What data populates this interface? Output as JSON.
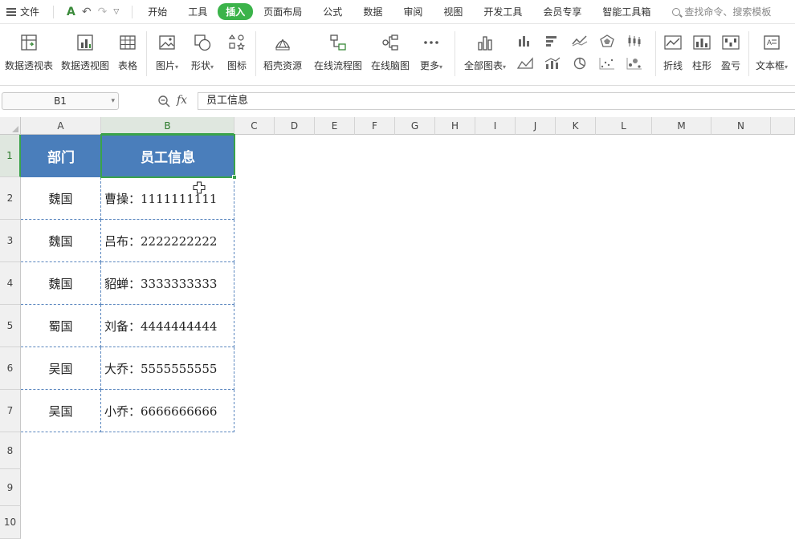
{
  "menu": {
    "file_label": "文件",
    "tabs": [
      "开始",
      "工具",
      "插入",
      "页面布局",
      "公式",
      "数据",
      "审阅",
      "视图",
      "开发工具",
      "会员专享",
      "智能工具箱"
    ],
    "active_tab": "插入",
    "search_placeholder": "查找命令、搜索模板"
  },
  "ribbon": {
    "pivot_table": "数据透视表",
    "pivot_chart": "数据透视图",
    "table": "表格",
    "picture": "图片",
    "shape": "形状",
    "icon": "图标",
    "resources": "稻壳资源",
    "flowchart": "在线流程图",
    "mindmap": "在线脑图",
    "more": "更多",
    "all_charts": "全部图表",
    "line": "折线",
    "column": "柱形",
    "winloss": "盈亏",
    "textbox": "文本框"
  },
  "formula_bar": {
    "name_box": "B1",
    "fx": "fx",
    "content": "员工信息"
  },
  "sheet": {
    "columns": [
      "A",
      "B",
      "C",
      "D",
      "E",
      "F",
      "G",
      "H",
      "I",
      "J",
      "K",
      "L",
      "M",
      "N"
    ],
    "rows": [
      "1",
      "2",
      "3",
      "4",
      "5",
      "6",
      "7",
      "8",
      "9",
      "10"
    ],
    "header": [
      "部门",
      "员工信息"
    ],
    "data": [
      [
        "魏国",
        "曹操：1111111111"
      ],
      [
        "魏国",
        "吕布：2222222222"
      ],
      [
        "魏国",
        "貂蝉：3333333333"
      ],
      [
        "蜀国",
        "刘备：4444444444"
      ],
      [
        "吴国",
        "大乔：5555555555"
      ],
      [
        "吴国",
        "小乔：6666666666"
      ]
    ]
  },
  "colors": {
    "accent": "#3bb34a",
    "header_fill": "#4a7ebb",
    "selection": "#3aa34a"
  }
}
